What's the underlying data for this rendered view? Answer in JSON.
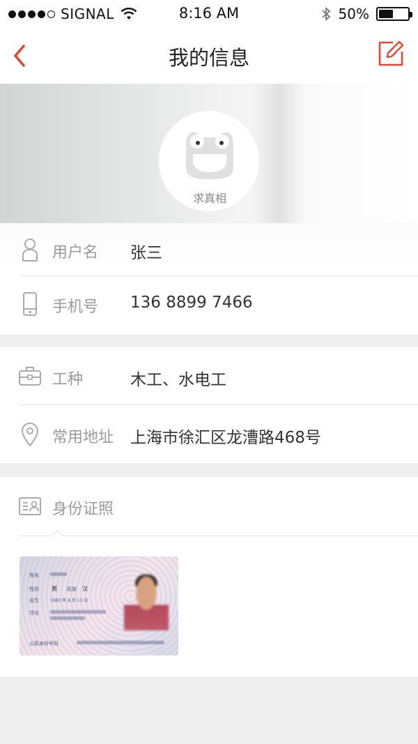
{
  "status_bar": {
    "carrier": "SIGNAL",
    "time": "8:16 AM",
    "battery_percent": "50%",
    "battery_level": 0.5,
    "signal_dots_filled": 4,
    "signal_dots_total": 5
  },
  "nav": {
    "title": "我的信息",
    "back_icon": "chevron-left-icon",
    "edit_icon": "edit-icon",
    "accent_color": "#e8432e"
  },
  "profile": {
    "avatar_caption": "求真相"
  },
  "fields": {
    "username": {
      "label": "用户名",
      "value": "张三",
      "icon": "user-icon"
    },
    "phone": {
      "label": "手机号",
      "value": "136 8899 7466",
      "icon": "phone-icon"
    },
    "trade": {
      "label": "工种",
      "value": "木工、水电工",
      "icon": "briefcase-icon"
    },
    "address": {
      "label": "常用地址",
      "value": "上海市徐汇区龙漕路468号",
      "icon": "location-pin-icon"
    },
    "id_photo": {
      "label": "身份证照",
      "icon": "id-card-icon"
    }
  },
  "id_card": {
    "name_label": "姓名",
    "gender_label": "性别",
    "gender_value": "男",
    "ethnic_label": "民族",
    "ethnic_value": "汉",
    "birth_label": "出生",
    "birth_value": "1983 年 8 月 13 日",
    "address_label": "住址",
    "id_number_label": "公民身份号码"
  }
}
